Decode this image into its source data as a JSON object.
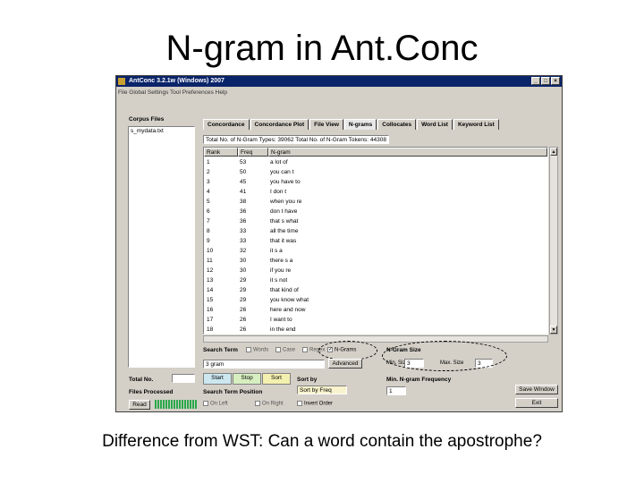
{
  "slide": {
    "title": "N-gram in Ant.Conc",
    "caption": "Difference from WST: Can a word contain the apostrophe?"
  },
  "window": {
    "title": "AntConc 3.2.1w (Windows) 2007",
    "menu": "File  Global Settings  Tool Preferences  Help",
    "controls": [
      "_",
      "□",
      "×"
    ]
  },
  "corpus": {
    "label": "Corpus Files",
    "files": [
      "s_mydata.txt"
    ],
    "total_label": "Total No.",
    "files_processed_label": "Files Processed",
    "read_button": "Read"
  },
  "tabs": [
    {
      "label": "Concordance",
      "active": false
    },
    {
      "label": "Concordance Plot",
      "active": false
    },
    {
      "label": "File View",
      "active": false
    },
    {
      "label": "N-grams",
      "active": true
    },
    {
      "label": "Collocates",
      "active": false
    },
    {
      "label": "Word List",
      "active": false
    },
    {
      "label": "Keyword List",
      "active": false
    }
  ],
  "stats": "Total No. of N-Gram Types: 39062    Total No. of N-Gram Tokens: 44308",
  "results": {
    "columns": [
      "Rank",
      "Freq",
      "N-gram"
    ],
    "rows": [
      {
        "rank": "1",
        "freq": "53",
        "ngram": "a lot of"
      },
      {
        "rank": "2",
        "freq": "50",
        "ngram": "you can t"
      },
      {
        "rank": "3",
        "freq": "45",
        "ngram": "you have to"
      },
      {
        "rank": "4",
        "freq": "41",
        "ngram": "I don t"
      },
      {
        "rank": "5",
        "freq": "38",
        "ngram": "when you re"
      },
      {
        "rank": "6",
        "freq": "36",
        "ngram": "don t have"
      },
      {
        "rank": "7",
        "freq": "36",
        "ngram": "that s what"
      },
      {
        "rank": "8",
        "freq": "33",
        "ngram": "all the time"
      },
      {
        "rank": "9",
        "freq": "33",
        "ngram": "that it was"
      },
      {
        "rank": "10",
        "freq": "32",
        "ngram": "it s a"
      },
      {
        "rank": "11",
        "freq": "30",
        "ngram": "there s a"
      },
      {
        "rank": "12",
        "freq": "30",
        "ngram": "if you re"
      },
      {
        "rank": "13",
        "freq": "29",
        "ngram": "it s not"
      },
      {
        "rank": "14",
        "freq": "29",
        "ngram": "that kind of"
      },
      {
        "rank": "15",
        "freq": "29",
        "ngram": "you know what"
      },
      {
        "rank": "16",
        "freq": "26",
        "ngram": "here and now"
      },
      {
        "rank": "17",
        "freq": "26",
        "ngram": "I want to"
      },
      {
        "rank": "18",
        "freq": "26",
        "ngram": "in the end"
      }
    ]
  },
  "search": {
    "label": "Search Term",
    "options": [
      "Words",
      "Case",
      "Regex",
      "N-Grams"
    ],
    "ngrams_checked": true,
    "value": "3 gram",
    "advanced_button": "Advanced",
    "position_label": "Search Term Position",
    "position_options": [
      "On Left",
      "On Right"
    ]
  },
  "ngram_size": {
    "label": "N-Gram Size",
    "min_label": "Min. Size",
    "min_value": "3",
    "max_label": "Max. Size",
    "max_value": "3"
  },
  "controls": {
    "start": "Start",
    "stop": "Stop",
    "sort": "Sort",
    "sort_by_label": "Sort by",
    "sort_by_value": "Sort by Freq",
    "invert_order": "Invert Order",
    "min_freq_label": "Min. N-gram Frequency",
    "min_freq_value": "1",
    "save_window": "Save Window",
    "exit": "Exit"
  },
  "colors": {
    "titlebar": "#0a246a",
    "start_button": "#cce7f0",
    "stop_button": "#d7efc0",
    "sort_button": "#f4f0b0",
    "progress": "#2aa84a"
  },
  "progress_fraction": 1.0
}
